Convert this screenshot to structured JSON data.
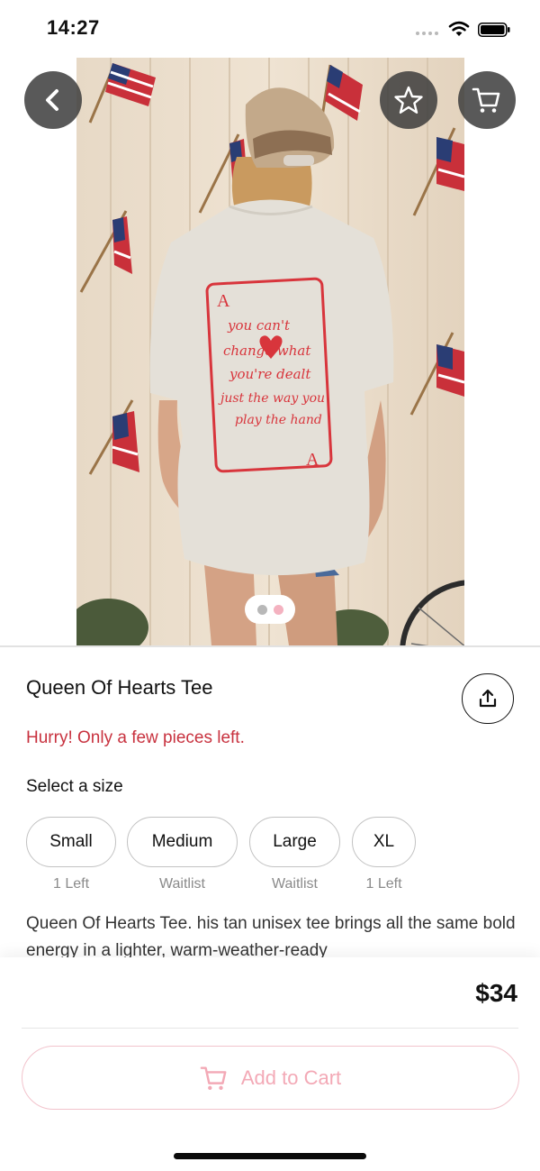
{
  "status_bar": {
    "time": "14:27"
  },
  "product": {
    "title": "Queen Of Hearts Tee",
    "stock_warning": "Hurry! Only a few pieces left.",
    "size_heading": "Select a size",
    "sizes": [
      {
        "label": "Small",
        "status": "1 Left"
      },
      {
        "label": "Medium",
        "status": "Waitlist"
      },
      {
        "label": "Large",
        "status": "Waitlist"
      },
      {
        "label": "XL",
        "status": "1 Left"
      }
    ],
    "description": "Queen Of Hearts Tee. his tan unisex tee brings all the same bold energy in a lighter, warm-weather-ready",
    "price": "$34"
  },
  "image_pager": {
    "count": 2,
    "active_index": 1
  },
  "cart_button": {
    "label": "Add to Cart"
  },
  "shirt_print": {
    "lines": [
      "you can't",
      "change what",
      "you're dealt",
      "just the way you",
      "play the hand"
    ],
    "card_rank": "A"
  },
  "colors": {
    "accent": "#d94a5c",
    "warning": "#c8323f",
    "cart_disabled": "#f3a9b6",
    "dot_inactive": "#b8b8b8",
    "dot_active": "#f4b2c0",
    "icon_button_bg": "#3c3c3c"
  },
  "icons": {
    "back": "chevron-left-icon",
    "favorite": "star-outline-icon",
    "cart": "cart-icon",
    "share": "share-icon"
  }
}
